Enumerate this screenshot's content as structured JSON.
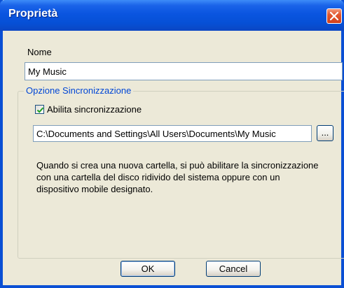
{
  "window": {
    "title": "Proprietà",
    "close_icon": "close-icon"
  },
  "name_section": {
    "label": "Nome",
    "value": "My Music"
  },
  "sync_group": {
    "title": "Opzione Sincronizzazione",
    "checkbox_label": "Abilita sincronizzazione",
    "checkbox_checked": true,
    "path_value": "C:\\Documents and Settings\\All Users\\Documents\\My Music",
    "browse_label": "...",
    "description": "Quando si crea una nuova cartella, si può abilitare la sincronizzazione con una cartella del disco ridivido del sistema oppure con un dispositivo mobile designato."
  },
  "buttons": {
    "ok_label": "OK",
    "cancel_label": "Cancel"
  },
  "colors": {
    "titlebar": "#0a55e0",
    "group_title": "#0046d5",
    "dialog_bg": "#ece9d8"
  }
}
